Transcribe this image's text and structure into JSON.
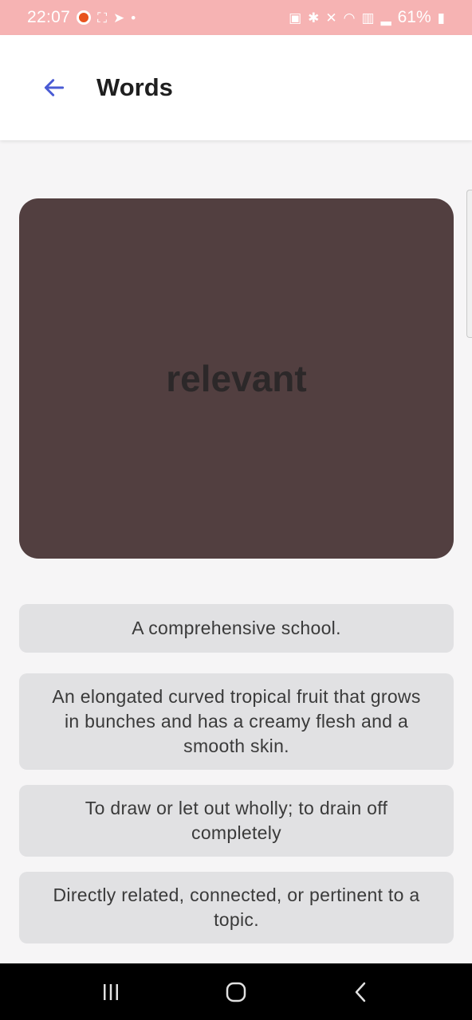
{
  "status_bar": {
    "time": "22:07",
    "battery": "61%",
    "icons_left": [
      "notification-dot-icon",
      "screenshot-icon",
      "telegram-icon",
      "dot-icon"
    ],
    "icons_right": [
      "battery-saver-icon",
      "bluetooth-icon",
      "mute-icon",
      "wifi-icon",
      "volte-icon",
      "signal-icon",
      "battery-icon"
    ]
  },
  "app_bar": {
    "title": "Words",
    "back_icon": "arrow-left-icon",
    "accent_color": "#4a5bd4"
  },
  "card": {
    "word": "relevant",
    "color": "#523f40"
  },
  "options": [
    {
      "text": "A comprehensive school."
    },
    {
      "text": "An elongated curved tropical fruit that grows in bunches and has a creamy flesh and a smooth skin."
    },
    {
      "text": "To draw or let out wholly; to drain off completely"
    },
    {
      "text": "Directly related, connected, or pertinent to a topic."
    }
  ],
  "nav_bar": {
    "items": [
      "recents-icon",
      "home-icon",
      "back-icon"
    ]
  }
}
